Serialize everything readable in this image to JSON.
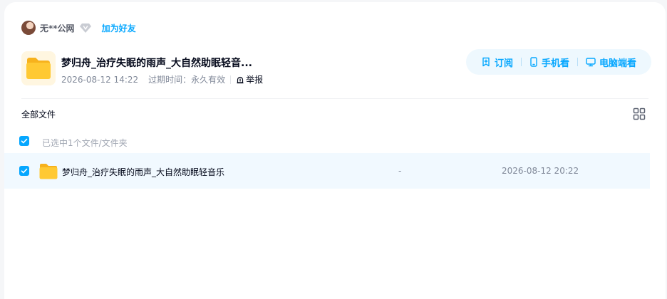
{
  "sharer": {
    "name": "无**公网",
    "add_friend": "加为好友"
  },
  "share": {
    "title": "梦归舟_治疗失眠的雨声_大自然助眠轻音...",
    "created": "2026-08-12 14:22",
    "expire_label": "过期时间：",
    "expire_value": "永久有效",
    "report": "举报"
  },
  "actions": {
    "subscribe": "订阅",
    "mobile": "手机看",
    "desktop": "电脑端看"
  },
  "colors": {
    "accent": "#06a7ff",
    "folder": "#ffc933"
  },
  "list": {
    "breadcrumb": "全部文件",
    "selected_text": "已选中1个文件/文件夹",
    "files": [
      {
        "name": "梦归舟_治疗失眠的雨声_大自然助眠轻音乐",
        "size": "-",
        "modified": "2026-08-12 20:22",
        "checked": true,
        "icon": "folder-icon"
      }
    ]
  }
}
